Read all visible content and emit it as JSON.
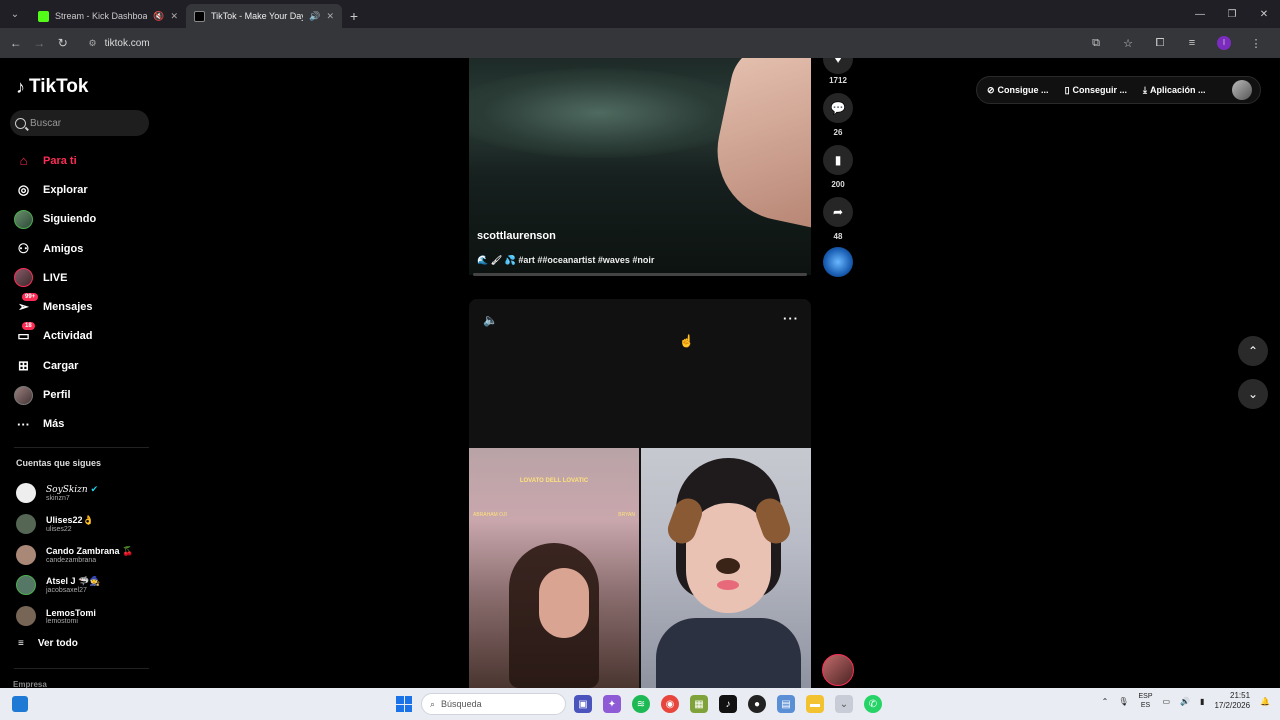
{
  "browser": {
    "tabs": [
      {
        "title": "Stream - Kick Dashboard",
        "favicon_color": "#53fc18"
      },
      {
        "title": "TikTok - Make Your Day",
        "favicon_color": "#ffffff"
      }
    ],
    "url": "tiktok.com"
  },
  "sidebar": {
    "logo": "TikTok",
    "search_placeholder": "Buscar",
    "nav": [
      {
        "label": "Para ti",
        "icon": "home-icon"
      },
      {
        "label": "Explorar",
        "icon": "compass-icon"
      },
      {
        "label": "Siguiendo",
        "icon": "following-avatar-icon"
      },
      {
        "label": "Amigos",
        "icon": "friends-icon"
      },
      {
        "label": "LIVE",
        "icon": "live-avatar-icon"
      },
      {
        "label": "Mensajes",
        "icon": "messages-icon",
        "badge": "99+"
      },
      {
        "label": "Actividad",
        "icon": "activity-icon",
        "badge": "18"
      },
      {
        "label": "Cargar",
        "icon": "upload-icon"
      },
      {
        "label": "Perfil",
        "icon": "profile-avatar-icon"
      },
      {
        "label": "Más",
        "icon": "more-dots-icon"
      }
    ],
    "following_title": "Cuentas que sigues",
    "accounts": [
      {
        "name": "SoySkizn",
        "handle": "skinzn7",
        "suffix": "✔"
      },
      {
        "name": "Ulises22",
        "handle": "ulises22",
        "suffix": "👌"
      },
      {
        "name": "Cando Zambrana",
        "handle": "candezambrana",
        "suffix": "🍒"
      },
      {
        "name": "Atsel J",
        "handle": "jacobsaxel27",
        "suffix": "🦈🧙"
      },
      {
        "name": "LemosTomi",
        "handle": "lemostomi",
        "suffix": ""
      }
    ],
    "see_all": "Ver todo",
    "company": "Empresa"
  },
  "feed": {
    "video1": {
      "author": "scottlaurenson",
      "caption": "🌊 🖌 💦 #art ##oceanartist #waves #noir"
    },
    "actions": [
      {
        "icon": "comment-icon",
        "count": "26"
      },
      {
        "icon": "bookmark-icon",
        "count": "200"
      },
      {
        "icon": "share-icon",
        "count": "48"
      }
    ],
    "like_count": "1712",
    "video2": {
      "live_banner": "LOVATO DELL LOVATIC",
      "live_left": "ABRAHAM OJI",
      "live_right": "BRYAN"
    }
  },
  "top_right": {
    "items": [
      "Consigue ...",
      "Conseguir ...",
      "Aplicación ..."
    ]
  },
  "taskbar": {
    "search_placeholder": "Búsqueda",
    "lang_top": "ESP",
    "lang_bottom": "ES",
    "time": "21:51",
    "date": "17/2/2026"
  }
}
